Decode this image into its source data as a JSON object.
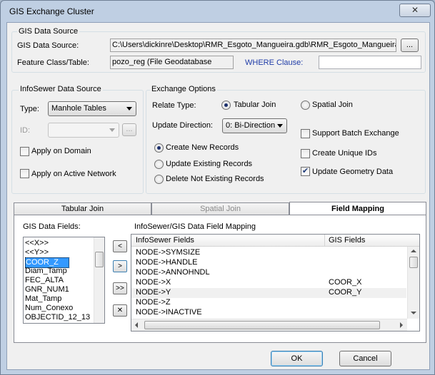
{
  "window": {
    "title": "GIS Exchange Cluster",
    "close_glyph": "✕"
  },
  "gis_source": {
    "group_title": "GIS Data Source",
    "source_label": "GIS Data Source:",
    "source_value": "C:\\Users\\dickinre\\Desktop\\RMR_Esgoto_Mangueira.gdb\\RMR_Esgoto_Mangueira",
    "browse_label": "...",
    "feature_label": "Feature Class/Table:",
    "feature_value": "pozo_reg (File Geodatabase",
    "where_label": "WHERE Clause:",
    "where_value": ""
  },
  "infosewer_source": {
    "group_title": "InfoSewer Data Source",
    "type_label": "Type:",
    "type_value": "Manhole Tables",
    "id_label": "ID:",
    "id_value": "",
    "id_browse_label": "...",
    "apply_domain_label": "Apply on Domain",
    "apply_network_label": "Apply on Active Network"
  },
  "exchange_options": {
    "group_title": "Exchange Options",
    "relate_type_label": "Relate Type:",
    "tabular_join_label": "Tabular Join",
    "spatial_join_label": "Spatial Join",
    "update_direction_label": "Update Direction:",
    "update_direction_value": "0: Bi-Direction",
    "support_batch_label": "Support Batch Exchange",
    "create_unique_ids_label": "Create Unique IDs",
    "update_geometry_label": "Update Geometry Data",
    "update_geometry_checked": "✔",
    "create_new_label": "Create New Records",
    "update_existing_label": "Update Existing Records",
    "delete_not_existing_label": "Delete Not Existing Records"
  },
  "tabs": {
    "tabular_join": "Tabular Join",
    "spatial_join": "Spatial Join",
    "field_mapping": "Field Mapping"
  },
  "field_mapping": {
    "gis_fields_label": "GIS Data Fields:",
    "gis_fields": [
      "<<X>>",
      "<<Y>>",
      "COOR_Z",
      "Diam_Tamp",
      "FEC_ALTA",
      "GNR_NUM1",
      "Mat_Tamp",
      "Num_Conexo",
      "OBJECTID_12_13"
    ],
    "mapping_label": "InfoSewer/GIS Data Field Mapping",
    "col_infosewer": "InfoSewer Fields",
    "col_gis": "GIS Fields",
    "rows": [
      {
        "info": "NODE->SYMSIZE",
        "gis": ""
      },
      {
        "info": "NODE->HANDLE",
        "gis": ""
      },
      {
        "info": "NODE->ANNOHNDL",
        "gis": ""
      },
      {
        "info": "NODE->X",
        "gis": "COOR_X"
      },
      {
        "info": "NODE->Y",
        "gis": "COOR_Y"
      },
      {
        "info": "NODE->Z",
        "gis": ""
      },
      {
        "info": "NODE->INACTIVE",
        "gis": ""
      }
    ],
    "btn_remove": "<",
    "btn_add": ">",
    "btn_add_all": ">>",
    "btn_clear": "✕"
  },
  "footer": {
    "ok_label": "OK",
    "cancel_label": "Cancel"
  }
}
